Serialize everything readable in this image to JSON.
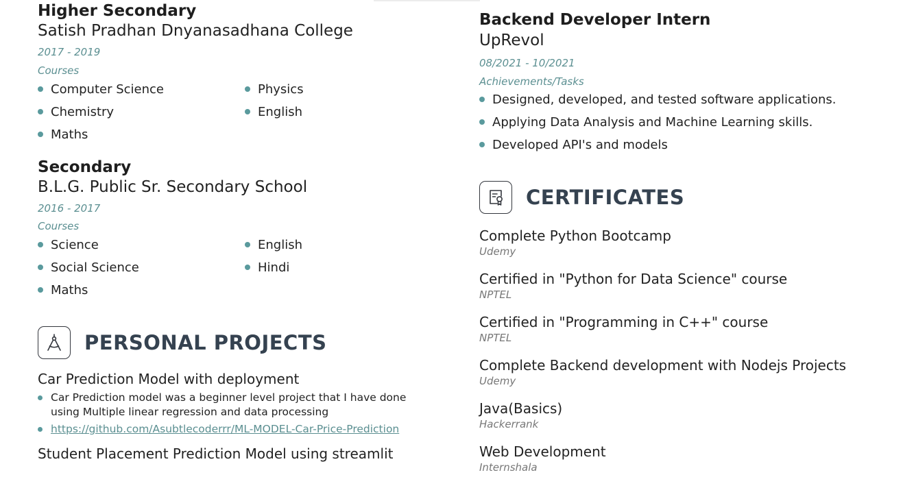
{
  "education": [
    {
      "level": "Higher Secondary",
      "school": "Satish Pradhan Dnyanasadhana College",
      "dates": "2017 - 2019",
      "courses_label": "Courses",
      "courses_left": [
        "Computer Science",
        "Chemistry",
        "Maths"
      ],
      "courses_right": [
        "Physics",
        "English"
      ]
    },
    {
      "level": "Secondary",
      "school": "B.L.G. Public Sr. Secondary School",
      "dates": "2016 - 2017",
      "courses_label": "Courses",
      "courses_left": [
        "Science",
        "Social Science",
        "Maths"
      ],
      "courses_right": [
        "English",
        "Hindi"
      ]
    }
  ],
  "projects": {
    "section_title": "PERSONAL PROJECTS",
    "icon": "compass-icon",
    "items": [
      {
        "title": "Car Prediction Model with deployment",
        "description": "Car Prediction model was a beginner level project that I have done using Multiple linear regression and data processing",
        "link": "https://github.com/Asubtlecoderrr/ML-MODEL-Car-Price-Prediction"
      },
      {
        "title": "Student Placement Prediction Model using streamlit"
      }
    ]
  },
  "experience": {
    "title": "Backend Developer Intern",
    "company": "UpRevol",
    "dates": "08/2021 - 10/2021",
    "tasks_label": "Achievements/Tasks",
    "tasks": [
      "Designed, developed, and tested software applications.",
      "Applying Data Analysis and Machine Learning skills.",
      "Developed API's and models"
    ]
  },
  "certificates": {
    "section_title": "CERTIFICATES",
    "icon": "certificate-icon",
    "items": [
      {
        "name": "Complete Python Bootcamp",
        "issuer": "Udemy"
      },
      {
        "name": "Certified in \"Python for Data Science\" course",
        "issuer": "NPTEL"
      },
      {
        "name": "Certified in \"Programming in C++\" course",
        "issuer": "NPTEL"
      },
      {
        "name": "Complete Backend development with Nodejs Projects",
        "issuer": "Udemy"
      },
      {
        "name": "Java(Basics)",
        "issuer": "Hackerrank"
      },
      {
        "name": "Web Development",
        "issuer": "Internshala"
      }
    ]
  },
  "colors": {
    "accent": "#5b8f91",
    "bullet": "#5a9a9d",
    "heading": "#354250"
  }
}
